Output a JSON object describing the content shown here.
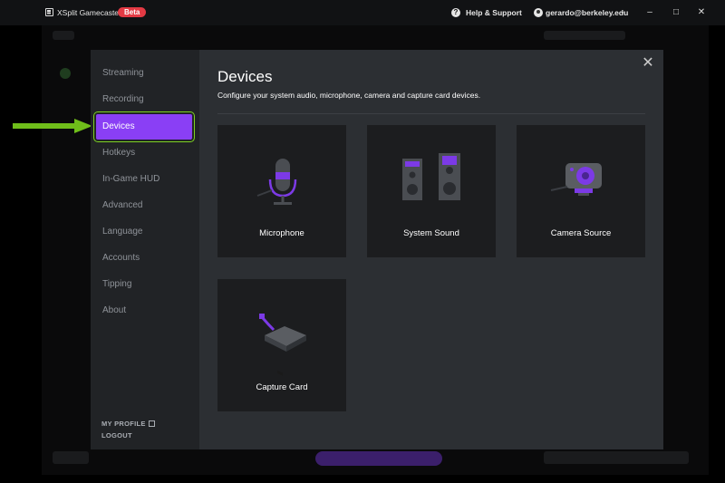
{
  "titlebar": {
    "app_title": "XSplit Gamecaster",
    "beta_badge": "Beta",
    "help_label": "Help & Support",
    "user_email": "gerardo@berkeley.edu",
    "window_buttons": [
      "minimize",
      "maximize",
      "close"
    ]
  },
  "modal": {
    "title": "Devices",
    "subtitle": "Configure your system audio, microphone, camera and capture card devices.",
    "sidebar": {
      "items": [
        {
          "label": "Streaming"
        },
        {
          "label": "Recording"
        },
        {
          "label": "Devices",
          "active": true
        },
        {
          "label": "Hotkeys"
        },
        {
          "label": "In-Game HUD"
        },
        {
          "label": "Advanced"
        },
        {
          "label": "Language"
        },
        {
          "label": "Accounts"
        },
        {
          "label": "Tipping"
        },
        {
          "label": "About"
        }
      ],
      "my_profile": "MY PROFILE",
      "logout": "LOGOUT"
    },
    "cards": [
      {
        "label": "Microphone",
        "icon": "microphone-icon"
      },
      {
        "label": "System Sound",
        "icon": "speakers-icon"
      },
      {
        "label": "Camera Source",
        "icon": "webcam-icon"
      },
      {
        "label": "Capture Card",
        "icon": "capture-card-icon"
      }
    ]
  },
  "colors": {
    "accent": "#8a3ff5",
    "highlight": "#7ed321",
    "arrow": "#6fbe1a",
    "badge": "#e33a44"
  }
}
